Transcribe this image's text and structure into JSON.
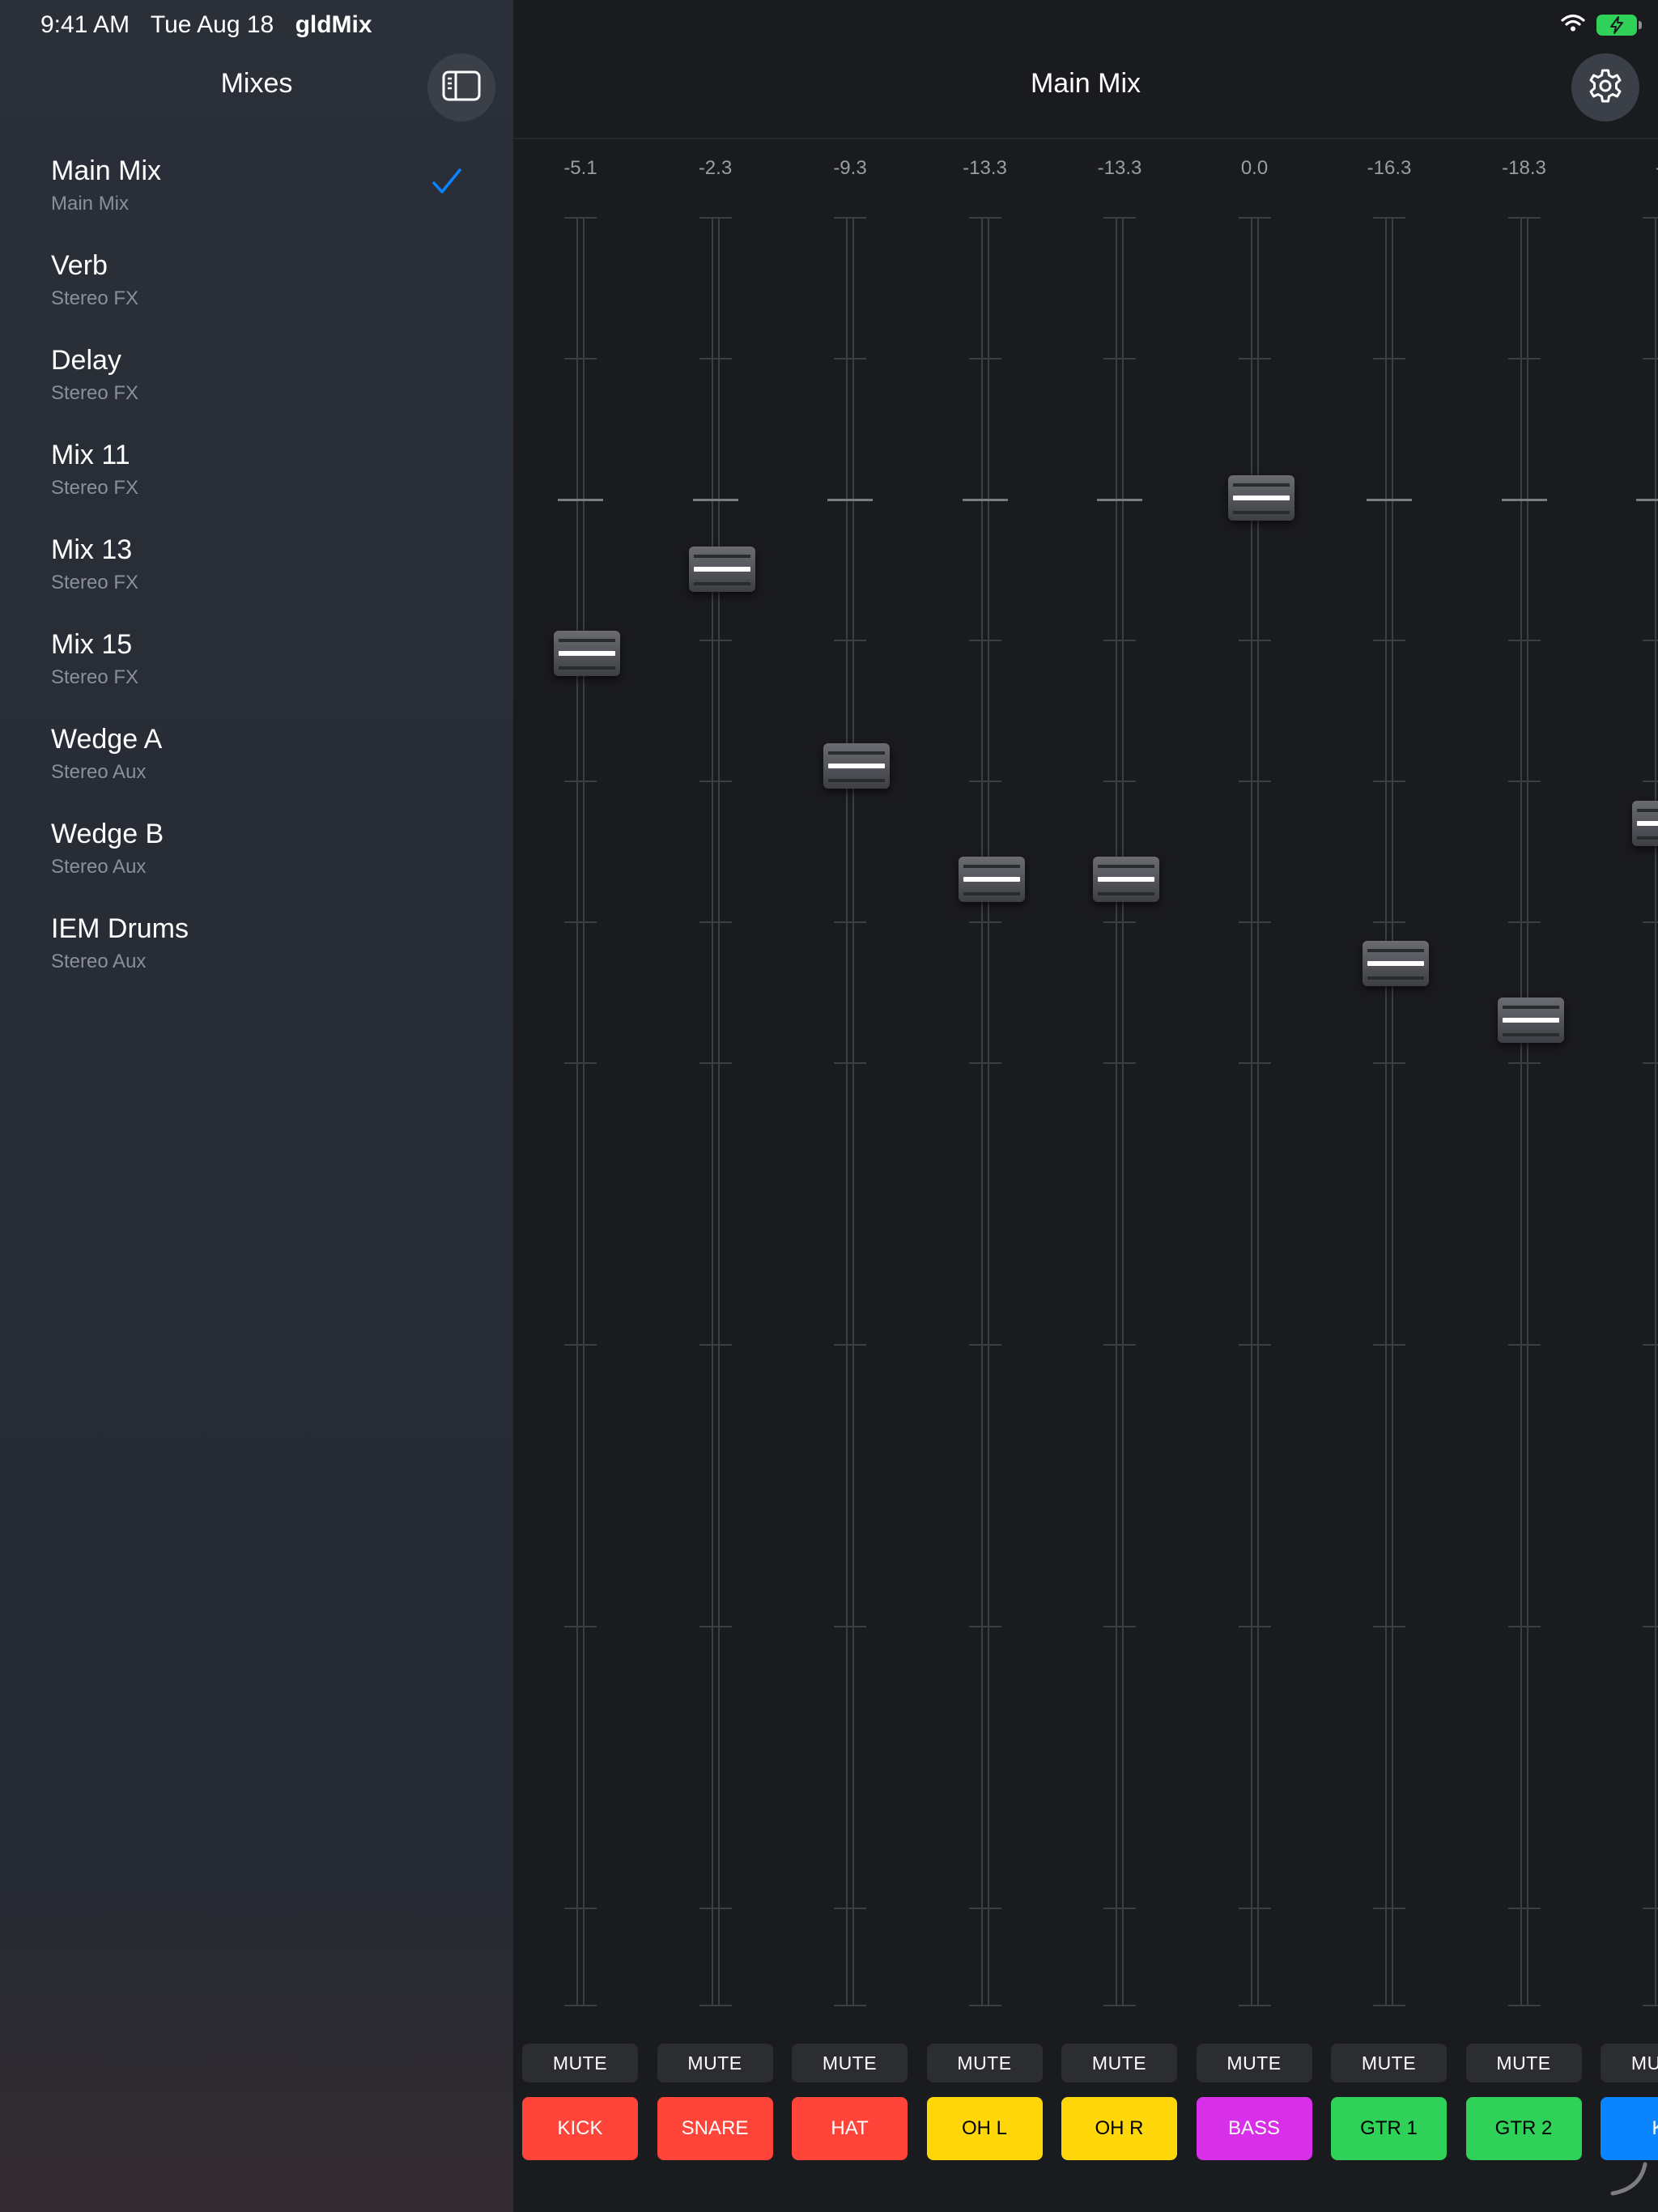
{
  "status_bar": {
    "time": "9:41 AM",
    "date": "Tue Aug 18",
    "app_name": "gldMix"
  },
  "sidebar": {
    "title": "Mixes",
    "items": [
      {
        "name": "Main Mix",
        "type": "Main Mix",
        "selected": true
      },
      {
        "name": "Verb",
        "type": "Stereo FX"
      },
      {
        "name": "Delay",
        "type": "Stereo FX"
      },
      {
        "name": "Mix 11",
        "type": "Stereo FX"
      },
      {
        "name": "Mix 13",
        "type": "Stereo FX"
      },
      {
        "name": "Mix 15",
        "type": "Stereo FX"
      },
      {
        "name": "Wedge A",
        "type": "Stereo Aux"
      },
      {
        "name": "Wedge B",
        "type": "Stereo Aux"
      },
      {
        "name": "IEM Drums",
        "type": "Stereo Aux"
      }
    ]
  },
  "main": {
    "title": "Main Mix",
    "mute_label": "MUTE",
    "channels": [
      {
        "level_db": "-5.1",
        "name": "KICK",
        "color": "#ff453a",
        "text_color": "#ffffff",
        "fader_level": 0.756
      },
      {
        "level_db": "-2.3",
        "name": "SNARE",
        "color": "#ff453a",
        "text_color": "#ffffff",
        "fader_level": 0.803
      },
      {
        "level_db": "-9.3",
        "name": "HAT",
        "color": "#ff453a",
        "text_color": "#ffffff",
        "fader_level": 0.693
      },
      {
        "level_db": "-13.3",
        "name": "OH L",
        "color": "#ffd60a",
        "text_color": "#000000",
        "fader_level": 0.63
      },
      {
        "level_db": "-13.3",
        "name": "OH R",
        "color": "#ffd60a",
        "text_color": "#000000",
        "fader_level": 0.63
      },
      {
        "level_db": "0.0",
        "name": "BASS",
        "color": "#d730e8",
        "text_color": "#ffffff",
        "fader_level": 0.843
      },
      {
        "level_db": "-16.3",
        "name": "GTR 1",
        "color": "#30d158",
        "text_color": "#000000",
        "fader_level": 0.583
      },
      {
        "level_db": "-18.3",
        "name": "GTR 2",
        "color": "#30d158",
        "text_color": "#000000",
        "fader_level": 0.551
      },
      {
        "level_db": "-",
        "name": "K",
        "color": "#0a84ff",
        "text_color": "#ffffff",
        "fader_level": 0.661
      }
    ]
  },
  "icons": {
    "sidebar_toggle": "sidebar-icon",
    "settings": "gear-icon",
    "check": "checkmark-icon"
  },
  "colors": {
    "accent": "#0a84ff"
  }
}
